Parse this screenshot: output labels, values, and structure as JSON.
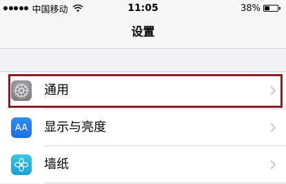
{
  "status_bar": {
    "carrier": "中国移动",
    "time": "11:05",
    "battery_percent": "38%",
    "battery_level": 0.38,
    "signal_icon": "signal-dots-icon",
    "wifi_icon": "wifi-icon",
    "battery_icon": "battery-icon"
  },
  "nav": {
    "title": "设置"
  },
  "settings": {
    "items": [
      {
        "label": "通用",
        "icon": "gear-icon",
        "highlighted": true
      },
      {
        "label": "显示与亮度",
        "icon": "display-brightness-icon",
        "icon_text": "AA"
      },
      {
        "label": "墙纸",
        "icon": "wallpaper-flower-icon"
      }
    ]
  },
  "colors": {
    "highlight_border": "#8b1a1f",
    "background": "#efeff4",
    "chevron": "#c7c7cc"
  }
}
